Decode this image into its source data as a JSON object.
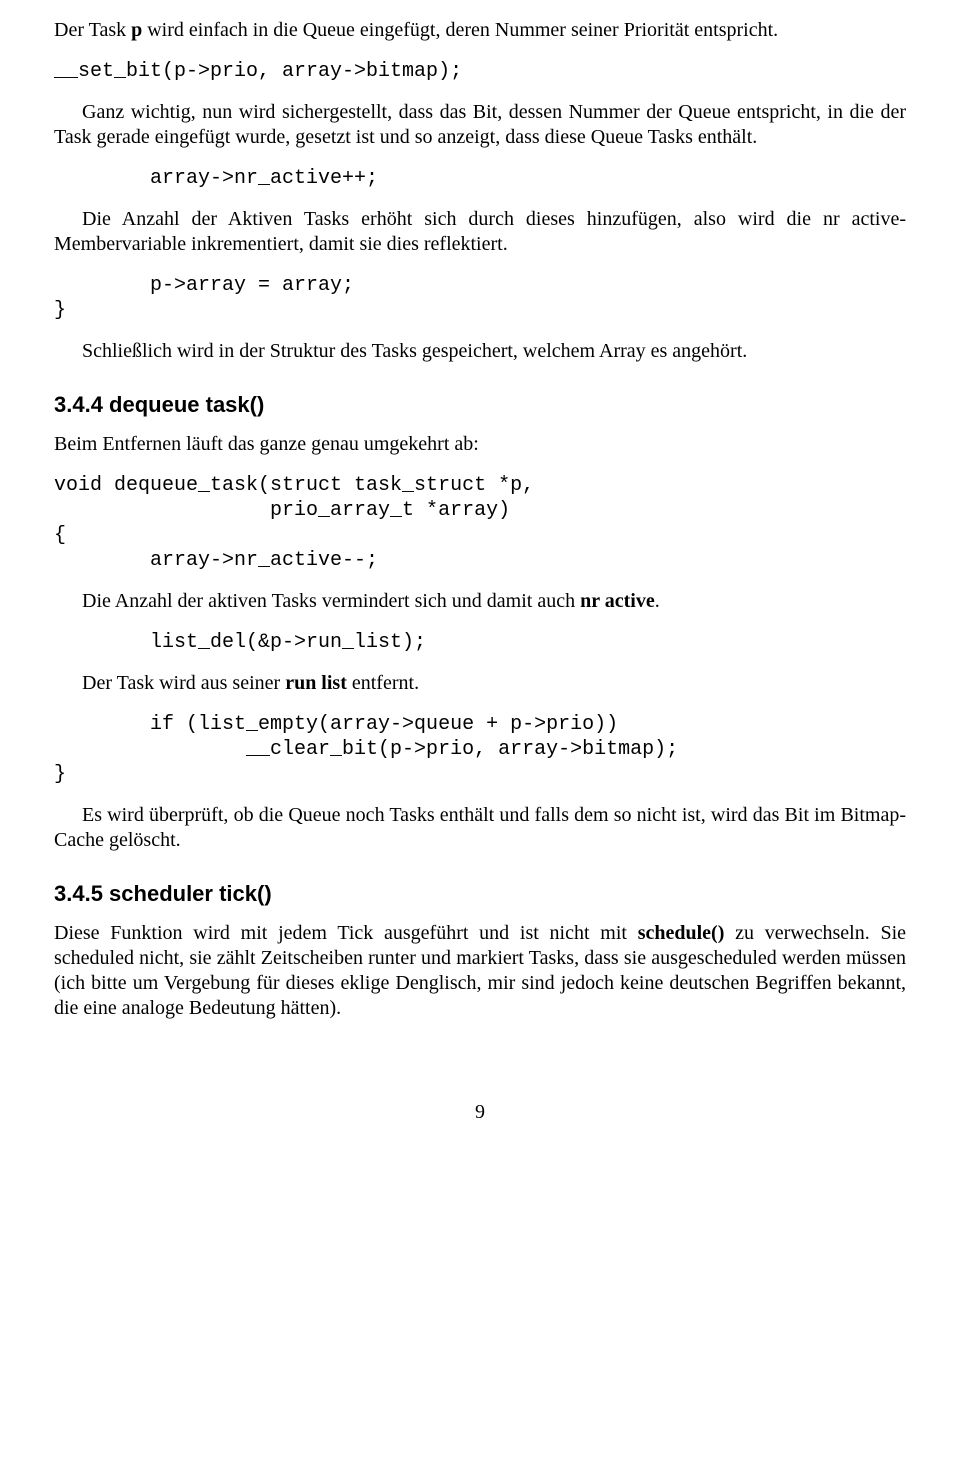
{
  "p1_pre": "Der Task ",
  "p1_b1": "p",
  "p1_post": " wird einfach in die Queue eingefügt, deren Nummer seiner Priorität entspricht.",
  "code1": "__set_bit(p->prio, array->bitmap);",
  "p2": "Ganz wichtig, nun wird sichergestellt, dass das Bit, dessen Nummer der Queue entspricht, in die der Task gerade eingefügt wurde, gesetzt ist und so anzeigt, dass diese Queue Tasks enthält.",
  "code2": "        array->nr_active++;",
  "p3": "Die Anzahl der Aktiven Tasks erhöht sich durch dieses hinzufügen, also wird die nr active-Membervariable inkrementiert, damit sie dies reflektiert.",
  "code3": "        p->array = array;\n}",
  "p4": "Schließlich wird in der Struktur des Tasks gespeichert, welchem Array es angehört.",
  "sec344": "3.4.4  dequeue task()",
  "p5": "Beim Entfernen läuft das ganze genau umgekehrt ab:",
  "code4": "void dequeue_task(struct task_struct *p,\n                  prio_array_t *array)\n{\n        array->nr_active--;",
  "p6_pre": "Die Anzahl der aktiven Tasks vermindert sich und damit auch ",
  "p6_b": "nr active",
  "p6_post": ".",
  "code5": "        list_del(&p->run_list);",
  "p7_pre": "Der Task wird aus seiner ",
  "p7_b": "run list",
  "p7_post": " entfernt.",
  "code6": "        if (list_empty(array->queue + p->prio))\n                __clear_bit(p->prio, array->bitmap);\n}",
  "p8": "Es wird überprüft, ob die Queue noch Tasks enthält und falls dem so nicht ist, wird das Bit im Bitmap-Cache gelöscht.",
  "sec345": "3.4.5  scheduler tick()",
  "p9_pre": "Diese Funktion wird mit jedem Tick ausgeführt und ist nicht mit ",
  "p9_b": "schedule()",
  "p9_post": " zu verwechseln. Sie scheduled nicht, sie zählt Zeitscheiben runter und markiert Tasks, dass sie ausgescheduled werden müssen (ich bitte um Vergebung für dieses eklige Denglisch, mir sind jedoch keine deutschen Begriffen bekannt, die eine analoge Bedeutung hätten).",
  "pagenum": "9"
}
